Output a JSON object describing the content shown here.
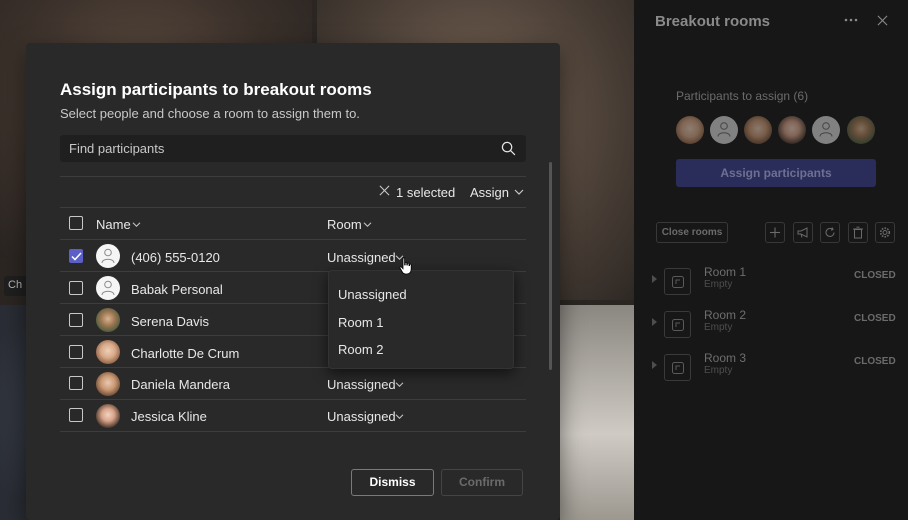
{
  "background": {
    "tile_label": "Ch"
  },
  "dialog": {
    "title": "Assign participants to breakout rooms",
    "subtitle": "Select people and choose a room to assign them to.",
    "search_placeholder": "Find participants",
    "selected_count": "1 selected",
    "assign_label": "Assign",
    "columns": {
      "name": "Name",
      "room": "Room"
    },
    "participants": [
      {
        "name": "(406) 555-0120",
        "room": "Unassigned",
        "checked": true,
        "avatar": "generic"
      },
      {
        "name": "Babak Personal",
        "room": "",
        "checked": false,
        "avatar": "generic"
      },
      {
        "name": "Serena Davis",
        "room": "",
        "checked": false,
        "avatar": "photo"
      },
      {
        "name": "Charlotte De Crum",
        "room": "",
        "checked": false,
        "avatar": "photo"
      },
      {
        "name": "Daniela Mandera",
        "room": "Unassigned",
        "checked": false,
        "avatar": "photo"
      },
      {
        "name": "Jessica Kline",
        "room": "Unassigned",
        "checked": false,
        "avatar": "photo"
      }
    ],
    "room_menu": [
      "Unassigned",
      "Room 1",
      "Room 2"
    ],
    "dismiss_label": "Dismiss",
    "confirm_label": "Confirm"
  },
  "panel": {
    "title": "Breakout rooms",
    "participants_to_assign": "Participants to assign (6)",
    "assign_button": "Assign participants",
    "close_rooms": "Close rooms",
    "rooms": [
      {
        "name": "Room 1",
        "sub": "Empty",
        "status": "CLOSED"
      },
      {
        "name": "Room 2",
        "sub": "Empty",
        "status": "CLOSED"
      },
      {
        "name": "Room 3",
        "sub": "Empty",
        "status": "CLOSED"
      }
    ]
  },
  "colors": {
    "accent": "#5b5fc7",
    "dialog_bg": "#292929",
    "panel_bg": "#171717"
  }
}
